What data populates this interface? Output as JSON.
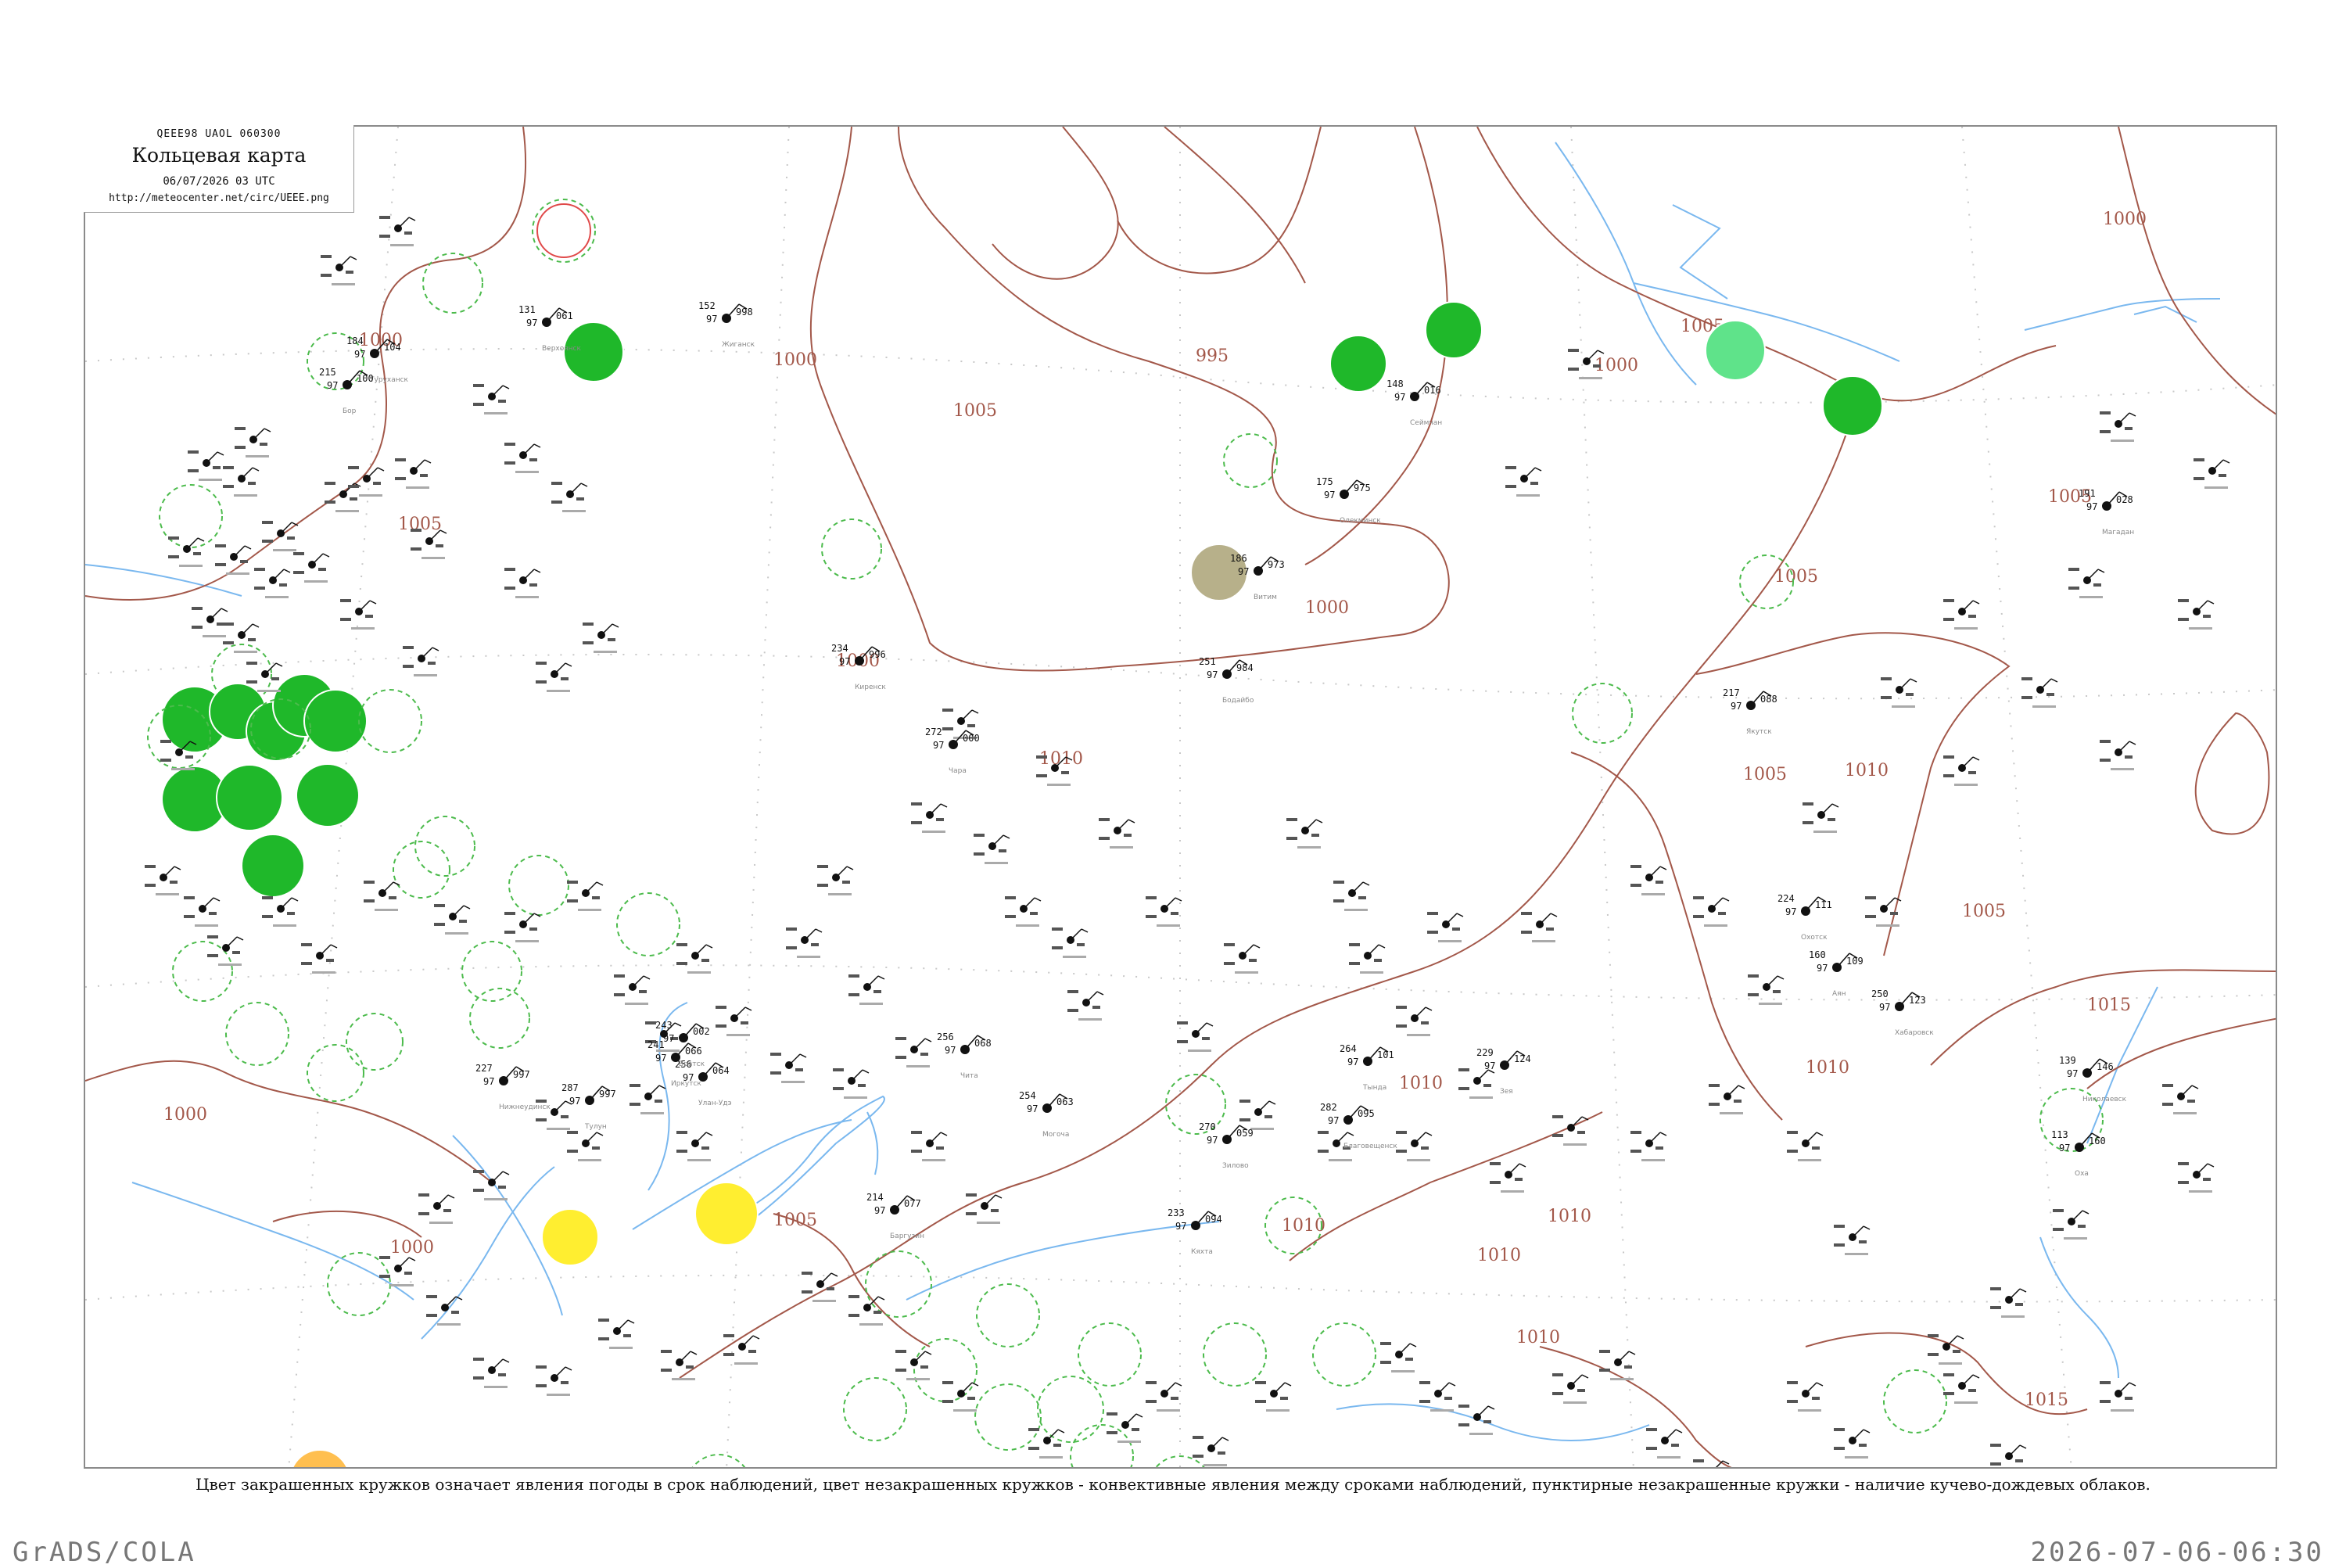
{
  "header": {
    "code": "QEEE98  UAOL  060300",
    "title": "Кольцевая карта",
    "datetime": "06/07/2026 03 UTC",
    "url": "http://meteocenter.net/circ/UEEE.png"
  },
  "caption": "Цвет закрашенных кружков означает явления погоды в срок наблюдений, цвет незакрашенных кружков - конвективные явления между сроками наблюдений, пунктирные незакрашенные кружки - наличие кучево-дождевых облаков.",
  "footer": {
    "software": "GrADS/COLA",
    "timestamp": "2026-07-06-06:30"
  },
  "colors": {
    "isobar": "#a3584a",
    "water": "#7ab8ef",
    "grid": "#c8c8c8",
    "green_filled": "#1fb82a",
    "light_green": "#5fe38a",
    "olive": "#b7b08a",
    "yellow": "#ffee30",
    "orange": "#ffbf50",
    "pale_yellow": "#ffff99",
    "cb_dashed": "#4cbb4c",
    "red_ring": "#e04a4a"
  },
  "isobars": [
    {
      "label": "1000"
    },
    {
      "label": "995"
    },
    {
      "label": "1000"
    },
    {
      "label": "1005"
    },
    {
      "label": "1000"
    },
    {
      "label": "1005"
    },
    {
      "label": "1000"
    },
    {
      "label": "1005"
    },
    {
      "label": "1000"
    },
    {
      "label": "1005"
    },
    {
      "label": "1010"
    },
    {
      "label": "1010"
    },
    {
      "label": "1010"
    },
    {
      "label": "1015"
    },
    {
      "label": "1010"
    },
    {
      "label": "1000"
    },
    {
      "label": "1005"
    },
    {
      "label": "1010"
    },
    {
      "label": "1010"
    },
    {
      "label": "1015"
    },
    {
      "label": "1005"
    },
    {
      "label": "1000"
    },
    {
      "label": "1005"
    },
    {
      "label": "1010"
    },
    {
      "label": "1010"
    },
    {
      "label": "1000"
    },
    {
      "label": "1005"
    }
  ],
  "stations": [
    {
      "name": "Сеймчан",
      "t": "148",
      "p": "016",
      "b": "97"
    },
    {
      "name": "Олекминск",
      "t": "175",
      "p": "975",
      "b": "97"
    },
    {
      "name": "Витим",
      "t": "186",
      "p": "973",
      "b": "97"
    },
    {
      "name": "Киренск",
      "t": "234",
      "p": "996",
      "b": "97"
    },
    {
      "name": "Бодайбо",
      "t": "251",
      "p": "984",
      "b": "97"
    },
    {
      "name": "Чара",
      "t": "272",
      "p": "000",
      "b": "97"
    },
    {
      "name": "Зилово",
      "t": "270",
      "p": "059",
      "b": "97"
    },
    {
      "name": "Нижнеудинск",
      "t": "227",
      "p": "997",
      "b": "97"
    },
    {
      "name": "Тулун",
      "t": "287",
      "p": "997",
      "b": "97"
    },
    {
      "name": "Чита",
      "t": "256",
      "p": "068",
      "b": "97"
    },
    {
      "name": "Могоча",
      "t": "254",
      "p": "063",
      "b": "97"
    },
    {
      "name": "Благовещенск",
      "t": "282",
      "p": "095",
      "b": "97"
    },
    {
      "name": "Хабаровск",
      "t": "250",
      "p": "123",
      "b": "97"
    },
    {
      "name": "Тында",
      "t": "264",
      "p": "101",
      "b": "97"
    },
    {
      "name": "Зея",
      "t": "229",
      "p": "124",
      "b": "97"
    },
    {
      "name": "Охотск",
      "t": "224",
      "p": "111",
      "b": "97"
    },
    {
      "name": "Аян",
      "t": "160",
      "p": "109",
      "b": "97"
    },
    {
      "name": "Николаевск",
      "t": "139",
      "p": "146",
      "b": "97"
    },
    {
      "name": "Оха",
      "t": "113",
      "p": "160",
      "b": "97"
    },
    {
      "name": "Магадан",
      "t": "191",
      "p": "028",
      "b": "97"
    },
    {
      "name": "Якутск",
      "t": "217",
      "p": "088",
      "b": "97"
    },
    {
      "name": "Иркутск",
      "t": "241",
      "p": "066",
      "b": "97"
    },
    {
      "name": "Улан-Удэ",
      "t": "256",
      "p": "064",
      "b": "97"
    },
    {
      "name": "Баргузин",
      "t": "214",
      "p": "077",
      "b": "97"
    },
    {
      "name": "Кяхта",
      "t": "233",
      "p": "094",
      "b": "97"
    },
    {
      "name": "Братск",
      "t": "243",
      "p": "002",
      "b": "97"
    },
    {
      "name": "Верхоянск",
      "t": "131",
      "p": "061",
      "b": "97"
    },
    {
      "name": "Жиганск",
      "t": "152",
      "p": "998",
      "b": "97"
    },
    {
      "name": "Туруханск",
      "t": "184",
      "p": "104",
      "b": "97"
    },
    {
      "name": "Бор",
      "t": "215",
      "p": "100",
      "b": "97"
    }
  ]
}
